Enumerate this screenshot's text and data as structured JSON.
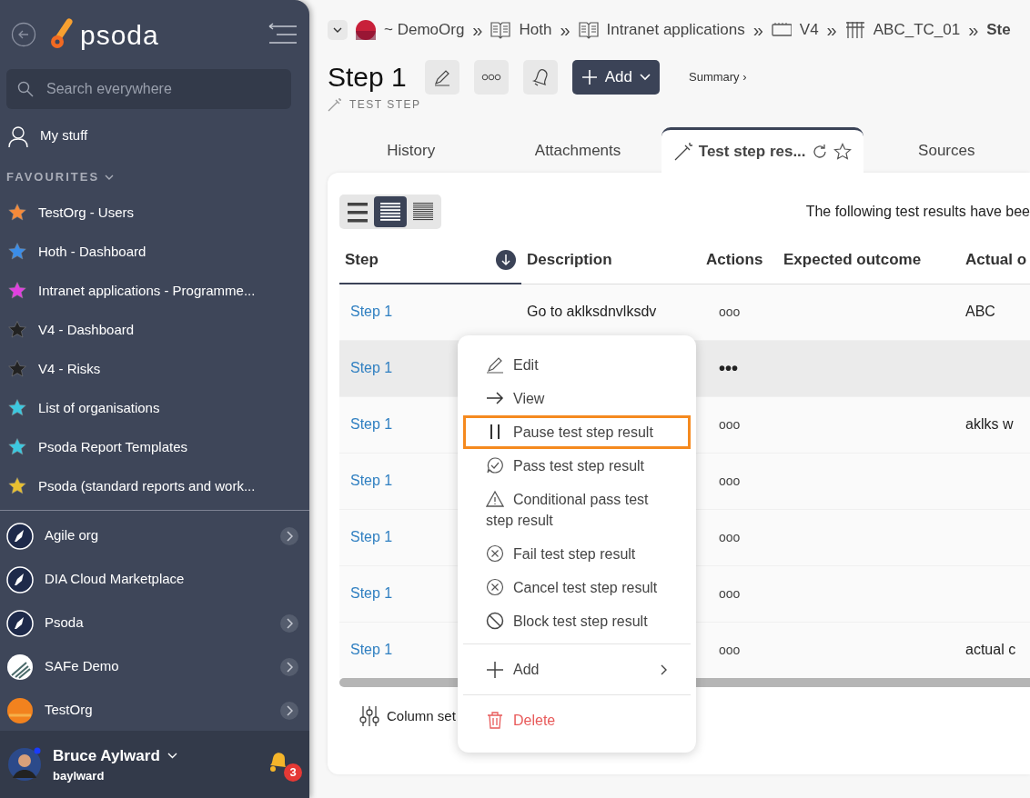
{
  "sidebar": {
    "logo": "psoda",
    "search": {
      "placeholder": "Search everywhere"
    },
    "my_stuff": "My stuff",
    "favourites_heading": "FAVOURITES",
    "favourites": [
      {
        "label": "TestOrg - Users",
        "color": "#f58a3a"
      },
      {
        "label": "Hoth - Dashboard",
        "color": "#3b8de8"
      },
      {
        "label": "Intranet applications - Programme...",
        "color": "#e040e0"
      },
      {
        "label": "V4 - Dashboard",
        "color": "#222222"
      },
      {
        "label": "V4 - Risks",
        "color": "#222222"
      },
      {
        "label": "List of organisations",
        "color": "#3cc8e0"
      },
      {
        "label": "Psoda Report Templates",
        "color": "#3cc8e0"
      },
      {
        "label": "Psoda (standard reports and work...",
        "color": "#e8c030"
      }
    ],
    "organisations": [
      {
        "label": "Agile org",
        "kind": "rocket",
        "expandable": true
      },
      {
        "label": "DIA Cloud Marketplace",
        "kind": "rocket",
        "expandable": false
      },
      {
        "label": "Psoda",
        "kind": "rocket",
        "expandable": true
      },
      {
        "label": "SAFe Demo",
        "kind": "stripes",
        "expandable": true
      },
      {
        "label": "TestOrg",
        "kind": "sun",
        "expandable": true
      }
    ],
    "user": {
      "name": "Bruce Aylward",
      "username": "baylward",
      "notifications": "3"
    }
  },
  "breadcrumbs": [
    {
      "label": "~ DemoOrg",
      "kind": "org"
    },
    {
      "label": "Hoth",
      "kind": "book"
    },
    {
      "label": "Intranet applications",
      "kind": "book"
    },
    {
      "label": "V4",
      "kind": "board"
    },
    {
      "label": "ABC_TC_01",
      "kind": "tubes"
    },
    {
      "label": "Ste",
      "kind": "current"
    }
  ],
  "breadcrumb_separator": "»",
  "page": {
    "title": "Step 1",
    "type": "TEST STEP",
    "add_button": "Add",
    "summary_link": "Summary ›"
  },
  "tabs": [
    {
      "label": "History",
      "selected": false
    },
    {
      "label": "Attachments",
      "selected": false
    },
    {
      "label": "Test step res...",
      "selected": true
    },
    {
      "label": "Sources",
      "selected": false
    }
  ],
  "view_modes": [
    {
      "selected": false
    },
    {
      "selected": true
    },
    {
      "selected": false
    }
  ],
  "notice": "The following test results have bee",
  "table": {
    "columns": [
      "Step",
      "Description",
      "Actions",
      "Expected outcome",
      "Actual o"
    ],
    "rows": [
      {
        "step": "Step 1",
        "description": "Go to aklksdnvlksdv",
        "actions": "ooo",
        "expected": "",
        "actual": "ABC",
        "hovered": false
      },
      {
        "step": "Step 1",
        "description": "",
        "actions": "•••",
        "expected": "",
        "actual": "",
        "hovered": true
      },
      {
        "step": "Step 1",
        "description": "",
        "actions": "ooo",
        "expected": "",
        "actual": "aklks w",
        "hovered": false
      },
      {
        "step": "Step 1",
        "description": "",
        "actions": "ooo",
        "expected": "",
        "actual": "",
        "hovered": false
      },
      {
        "step": "Step 1",
        "description": "",
        "actions": "ooo",
        "expected": "",
        "actual": "",
        "hovered": false
      },
      {
        "step": "Step 1",
        "description": "",
        "actions": "ooo",
        "expected": "",
        "actual": "",
        "hovered": false
      },
      {
        "step": "Step 1",
        "description": "",
        "actions": "ooo",
        "expected": "",
        "actual": "actual c",
        "hovered": false
      }
    ]
  },
  "column_settings": "Column set",
  "menu": {
    "items": [
      {
        "kind": "edit",
        "label": "Edit",
        "highlighted": false
      },
      {
        "kind": "view",
        "label": "View",
        "highlighted": false
      },
      {
        "kind": "pause",
        "label": "Pause test step result",
        "highlighted": true
      },
      {
        "kind": "pass",
        "label": "Pass test step result",
        "highlighted": false
      },
      {
        "kind": "conditional",
        "label": "Conditional pass test step result",
        "highlighted": false
      },
      {
        "kind": "fail",
        "label": "Fail test step result",
        "highlighted": false
      },
      {
        "kind": "cancel",
        "label": "Cancel test step result",
        "highlighted": false
      },
      {
        "kind": "block",
        "label": "Block test step result",
        "highlighted": false
      },
      {
        "kind": "add",
        "label": "Add",
        "highlighted": false
      },
      {
        "kind": "delete",
        "label": "Delete",
        "highlighted": false
      }
    ]
  }
}
